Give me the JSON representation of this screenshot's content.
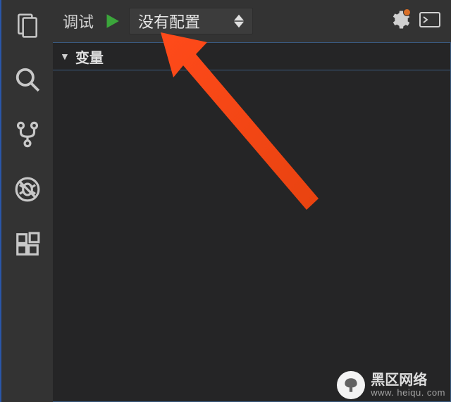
{
  "toolbar": {
    "title": "调试",
    "config_selected": "没有配置"
  },
  "section": {
    "variables_title": "变量"
  },
  "activity": {
    "explorer": "explorer",
    "search": "search",
    "scm": "source-control",
    "debug": "debug",
    "extensions": "extensions"
  },
  "watermark": {
    "title": "黑区网络",
    "url": "www. heiqu. com"
  }
}
